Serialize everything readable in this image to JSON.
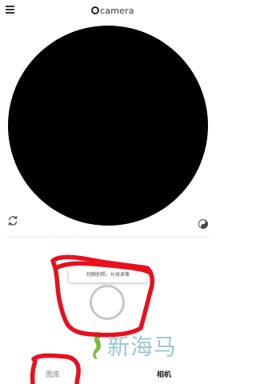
{
  "header": {
    "menu_icon": "menu-icon",
    "title": "camera"
  },
  "viewfinder": {
    "background": "#000000"
  },
  "controls": {
    "switch_camera_icon": "switch-camera-icon",
    "filter_icon": "yin-yang-icon"
  },
  "shutter": {
    "tooltip": "轻触拍照，长按录像",
    "ring_color": "#c6c6c6"
  },
  "watermark": {
    "text": "新海马",
    "color": "#9bc7cf"
  },
  "annotation": {
    "color": "#e8101e"
  },
  "tabs": [
    {
      "label": "图库",
      "active": false
    },
    {
      "label": "相机",
      "active": true
    }
  ]
}
